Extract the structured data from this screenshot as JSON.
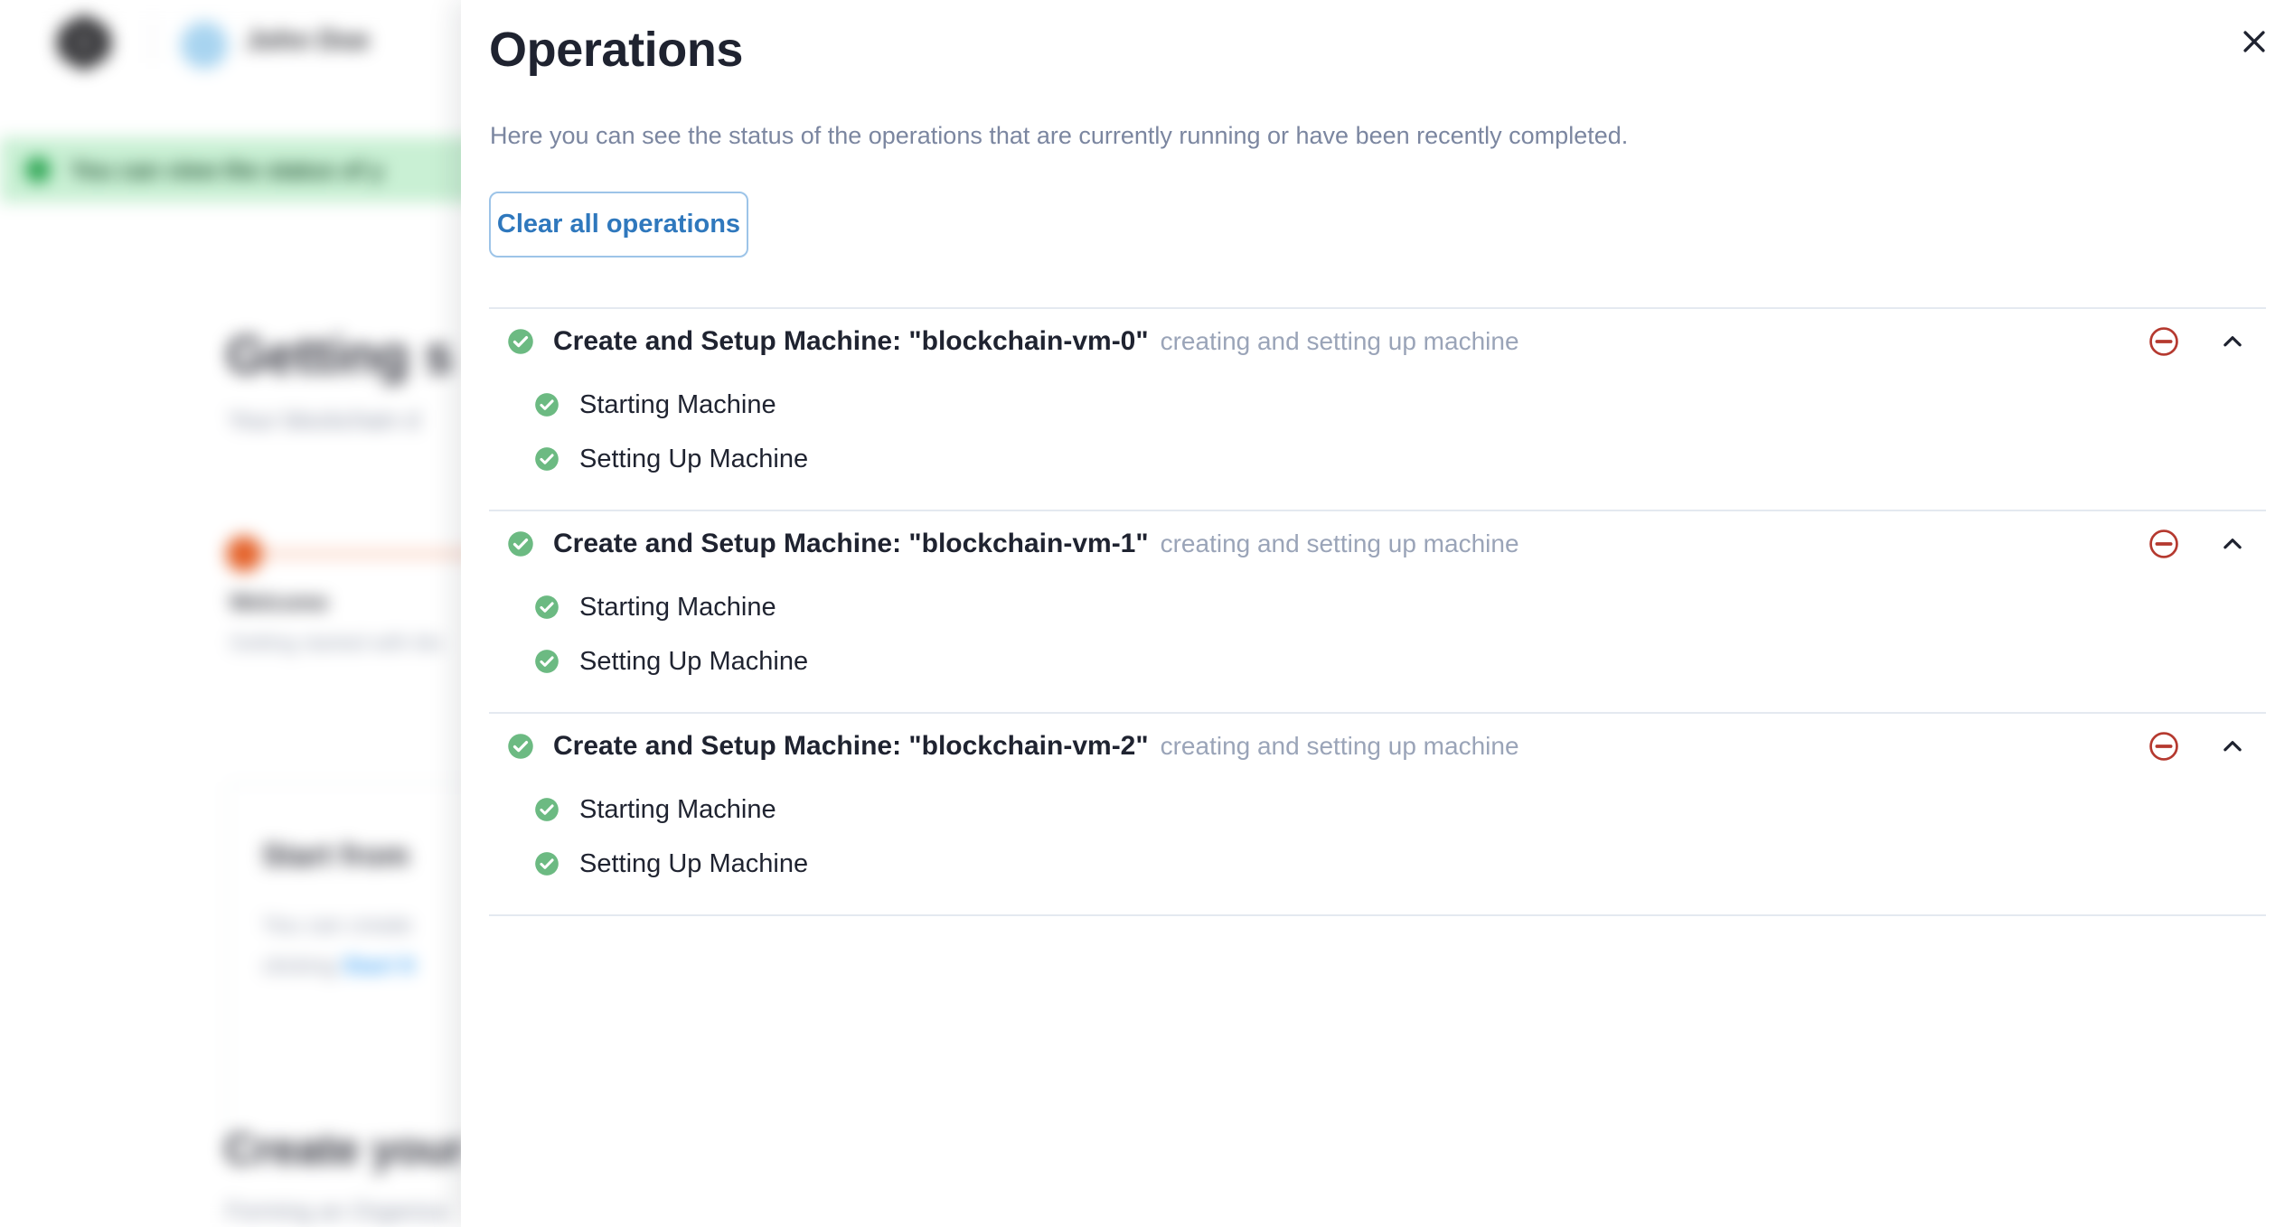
{
  "background": {
    "user_name": "John Doe",
    "banner_text": "You can view the status of y",
    "page_heading": "Getting s",
    "page_subheading": "Your blockchain d",
    "progress_step_label": "Welcome",
    "progress_step_sub": "Getting started with blo",
    "card_title": "Start from",
    "card_body_line1": "You can create",
    "card_body_line2_prefix": "clicking ",
    "card_body_link": "Start fr",
    "section2_heading": "Create your O",
    "section2_sub": "Forming an Organiza",
    "accent_orange": "#e4622a",
    "accent_green": "#24a14c",
    "accent_blue": "#49a6f5"
  },
  "drawer": {
    "title": "Operations",
    "subtitle": "Here you can see the status of the operations that are currently running or have been recently completed.",
    "clear_button_label": "Clear all operations",
    "close_icon": "close-icon",
    "colors": {
      "title": "#1f2330",
      "subtitle": "#7b86a0",
      "button_border": "#9dc4e8",
      "button_text": "#2f78bd",
      "success_green": "#6cba82",
      "remove_red": "#b5392f",
      "divider": "#e4e9f0",
      "muted_text": "#9aa4b8"
    },
    "operations": [
      {
        "status": "success",
        "status_icon": "check-circle-icon",
        "title": "Create and Setup Machine: \"blockchain-vm-0\"",
        "description": "creating and setting up machine",
        "remove_icon": "minus-circle-icon",
        "collapse_icon": "chevron-up-icon",
        "expanded": true,
        "steps": [
          {
            "status_icon": "check-circle-icon",
            "label": "Starting Machine"
          },
          {
            "status_icon": "check-circle-icon",
            "label": "Setting Up Machine"
          }
        ]
      },
      {
        "status": "success",
        "status_icon": "check-circle-icon",
        "title": "Create and Setup Machine: \"blockchain-vm-1\"",
        "description": "creating and setting up machine",
        "remove_icon": "minus-circle-icon",
        "collapse_icon": "chevron-up-icon",
        "expanded": true,
        "steps": [
          {
            "status_icon": "check-circle-icon",
            "label": "Starting Machine"
          },
          {
            "status_icon": "check-circle-icon",
            "label": "Setting Up Machine"
          }
        ]
      },
      {
        "status": "success",
        "status_icon": "check-circle-icon",
        "title": "Create and Setup Machine: \"blockchain-vm-2\"",
        "description": "creating and setting up machine",
        "remove_icon": "minus-circle-icon",
        "collapse_icon": "chevron-up-icon",
        "expanded": true,
        "steps": [
          {
            "status_icon": "check-circle-icon",
            "label": "Starting Machine"
          },
          {
            "status_icon": "check-circle-icon",
            "label": "Setting Up Machine"
          }
        ]
      }
    ]
  }
}
